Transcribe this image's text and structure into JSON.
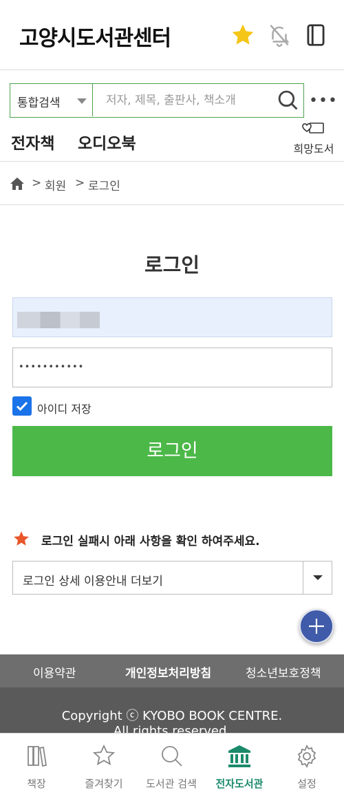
{
  "header": {
    "title": "고양시도서관센터"
  },
  "search": {
    "scope_selected": "통합검색",
    "placeholder": "저자, 제목, 출판사, 책소개",
    "more": "•••"
  },
  "categories": {
    "items": [
      "전자책",
      "오디오북"
    ],
    "wish_label": "희망도서"
  },
  "breadcrumb": {
    "sep": ">",
    "items": [
      "회원",
      "로그인"
    ]
  },
  "login": {
    "title": "로그인",
    "password_mask": "•••••••••••",
    "remember_label": "아이디 저장",
    "remember_checked": true,
    "button_label": "로그인"
  },
  "notice": {
    "text": "로그인 실패시 아래 사항을 확인 하여주세요.",
    "guide_selected": "로그인 상세 이용안내 더보기"
  },
  "footer": {
    "links": [
      "이용약관",
      "개인정보처리방침",
      "청소년보호정책"
    ],
    "copyright_line1": "Copyright ⓒ KYOBO BOOK CENTRE.",
    "copyright_line2": "All rights reserved."
  },
  "tabbar": {
    "tabs": [
      {
        "label": "책장",
        "icon": "bookshelf-icon",
        "active": false
      },
      {
        "label": "즐겨찾기",
        "icon": "star-outline-icon",
        "active": false
      },
      {
        "label": "도서관 검색",
        "icon": "search-icon",
        "active": false
      },
      {
        "label": "전자도서관",
        "icon": "library-icon",
        "active": true
      },
      {
        "label": "설정",
        "icon": "gear-icon",
        "active": false
      }
    ]
  },
  "colors": {
    "accent_green": "#4cb848",
    "active_tab": "#1b8a6b",
    "fab_blue": "#3f5ba9",
    "star_yellow": "#f5c518"
  }
}
